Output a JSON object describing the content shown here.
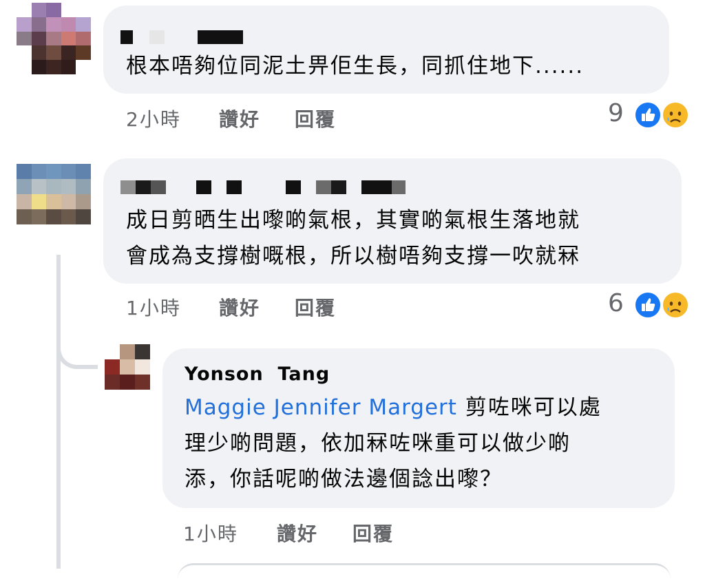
{
  "comments": [
    {
      "text": "根本唔夠位同泥土畀佢生長，同抓住地下......",
      "time": "2小時",
      "like_label": "讚好",
      "reply_label": "回覆",
      "reaction_count": "9",
      "reactions": [
        "like-icon",
        "sad-icon"
      ]
    },
    {
      "text_lines": [
        "成日剪晒生出嚟啲氣根，其實啲氣根生落地就",
        "會成為支撐樹嘅根，所以樹唔夠支撐一吹就冧"
      ],
      "time": "1小時",
      "like_label": "讚好",
      "reply_label": "回覆",
      "reaction_count": "6",
      "reactions": [
        "like-icon",
        "sad-icon"
      ]
    }
  ],
  "reply": {
    "author": "Yonson  Tang",
    "mention": "Maggie Jennifer Margert",
    "text_line1": " 剪咗咪可以處",
    "text_line2": "理少啲問題，依加冧咗咪重可以做少啲",
    "text_line3": "添，你話呢啲做法邊個諗出嚟？",
    "time": "1小時",
    "like_label": "讚好",
    "reply_label": "回覆"
  },
  "colors": {
    "bubble": "#f0f2f5",
    "link": "#216fdb",
    "meta": "#65676b",
    "like": "#1877f2",
    "sad": "#f7b928"
  }
}
